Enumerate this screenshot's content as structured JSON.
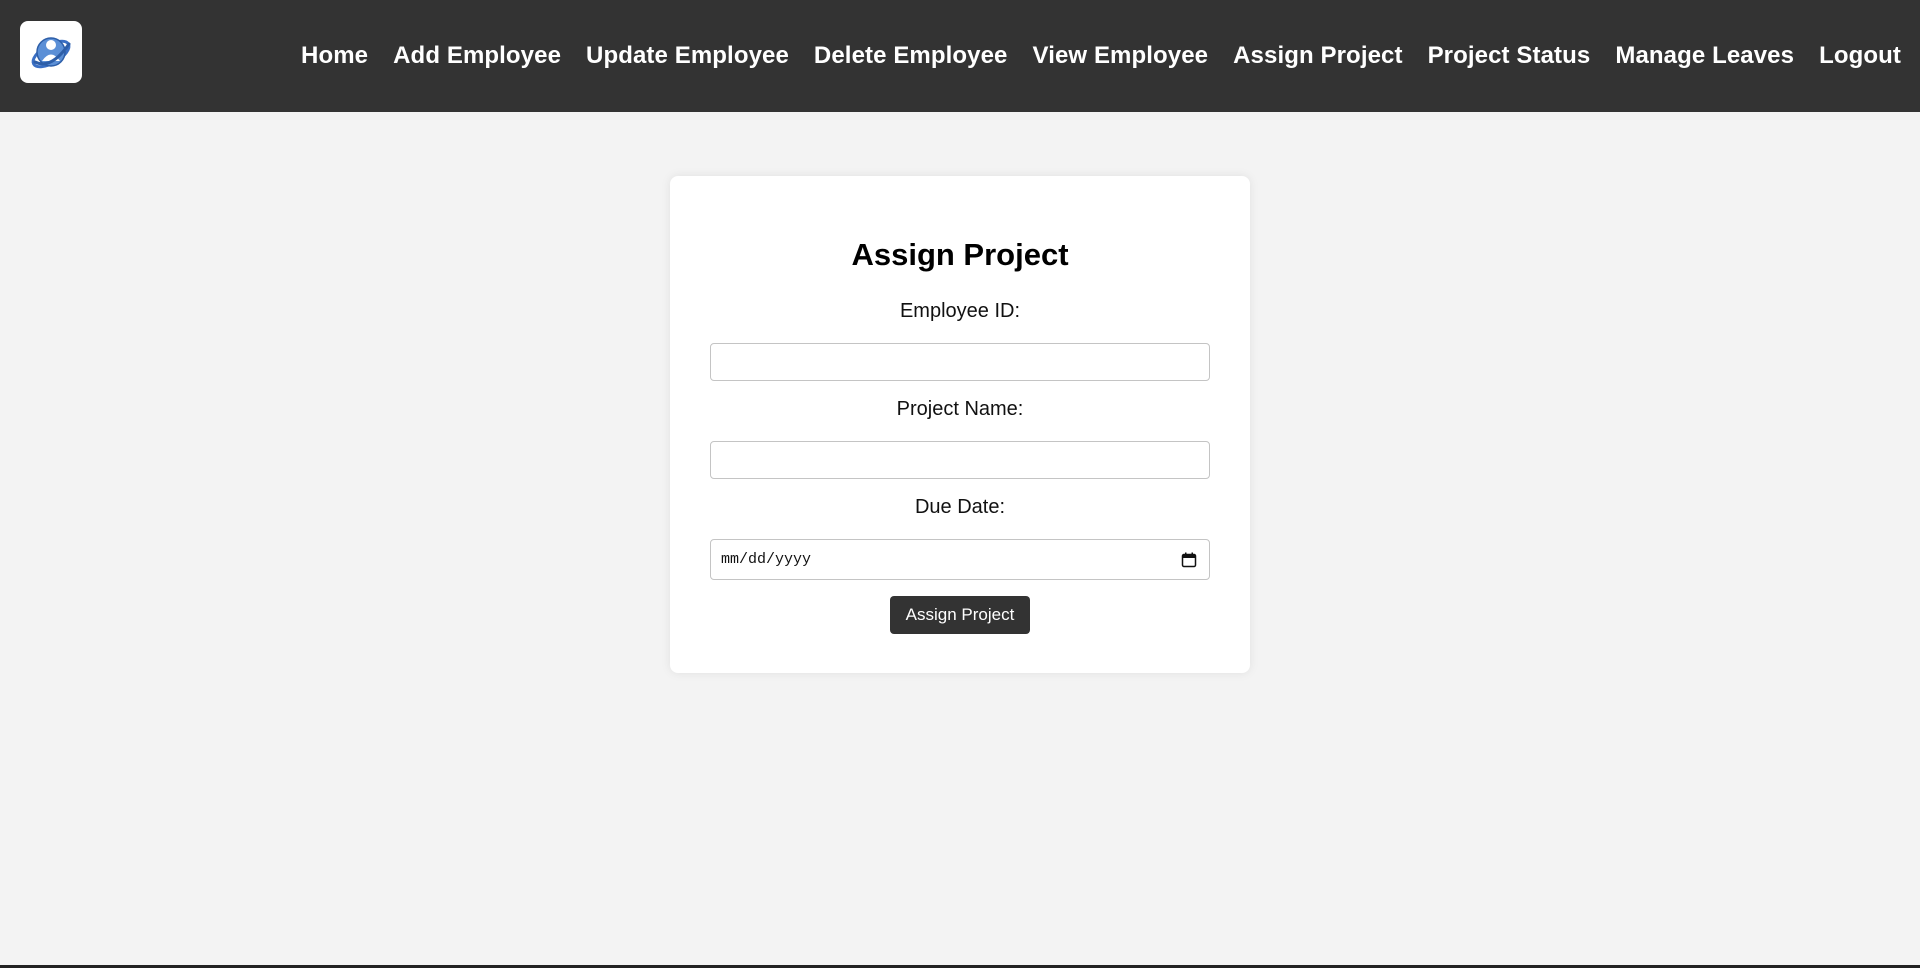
{
  "nav": {
    "logo_icon": "employee-globe-icon",
    "links": [
      {
        "label": "Home"
      },
      {
        "label": "Add Employee"
      },
      {
        "label": "Update Employee"
      },
      {
        "label": "Delete Employee"
      },
      {
        "label": "View Employee"
      },
      {
        "label": "Assign Project"
      },
      {
        "label": "Project Status"
      },
      {
        "label": "Manage Leaves"
      },
      {
        "label": "Logout"
      }
    ]
  },
  "form": {
    "title": "Assign Project",
    "employee_id": {
      "label": "Employee ID:",
      "value": ""
    },
    "project_name": {
      "label": "Project Name:",
      "value": ""
    },
    "due_date": {
      "label": "Due Date:",
      "placeholder": "mm/dd/yyyy",
      "icon": "calendar-icon"
    },
    "submit_label": "Assign Project"
  },
  "colors": {
    "navbar_bg": "#333333",
    "page_bg": "#f3f3f3",
    "card_bg": "#ffffff",
    "button_bg": "#333333"
  }
}
